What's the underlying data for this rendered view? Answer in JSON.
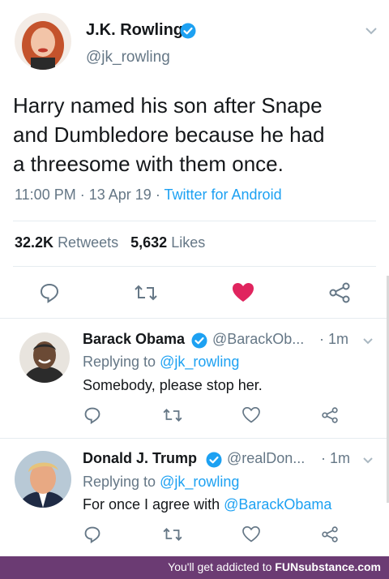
{
  "tweet": {
    "author_name": "J.K. Rowling",
    "author_handle": "@jk_rowling",
    "text_lines": [
      "Harry named his son after Snape",
      "and Dumbledore because he had",
      "a threesome with them once."
    ],
    "time": "11:00 PM",
    "date": "13 Apr 19",
    "sep": "·",
    "source": "Twitter for Android",
    "retweets_count": "32.2K",
    "retweets_label": "Retweets",
    "likes_count": "5,632",
    "likes_label": "Likes",
    "liked": true,
    "like_color": "#e0245e"
  },
  "replies": [
    {
      "name": "Barack Obama",
      "handle": "@BarackOb...",
      "time": "· 1m",
      "replying_label": "Replying to",
      "replying_to": "@jk_rowling",
      "text": "Somebody, please stop her.",
      "mention": ""
    },
    {
      "name": "Donald J. Trump",
      "handle": "@realDon...",
      "time": "· 1m",
      "replying_label": "Replying to",
      "replying_to": "@jk_rowling",
      "text": "For once I agree with",
      "mention": "@BarackObama"
    }
  ],
  "icons": {
    "reply": "reply-icon",
    "retweet": "retweet-icon",
    "like": "heart-icon",
    "share": "share-icon",
    "verified": "verified-badge-icon",
    "menu": "chevron-down-icon"
  },
  "colors": {
    "accent": "#1da1f2",
    "verified": "#1da1f2",
    "footer_bg": "#6b3b73"
  },
  "footer": {
    "text": "You'll get addicted to",
    "brand": "FUNsubstance.com"
  }
}
